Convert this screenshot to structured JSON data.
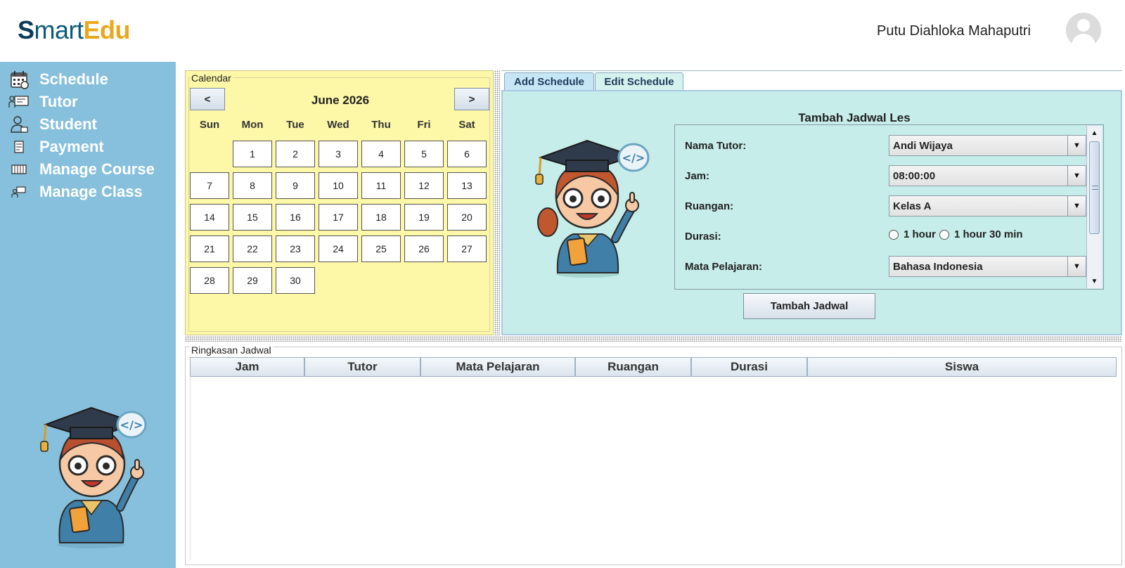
{
  "header": {
    "logo": {
      "s": "S",
      "mart": "mart",
      "edu": "Edu"
    },
    "user_name": "Putu Diahloka Mahaputri"
  },
  "sidebar": {
    "items": [
      {
        "label": "Schedule",
        "icon": "calendar-icon"
      },
      {
        "label": "Tutor",
        "icon": "tutor-icon"
      },
      {
        "label": "Student",
        "icon": "student-icon"
      },
      {
        "label": "Payment",
        "icon": "payment-icon"
      },
      {
        "label": "Manage Course",
        "icon": "course-icon"
      },
      {
        "label": "Manage Class",
        "icon": "class-icon"
      }
    ]
  },
  "calendar": {
    "legend": "Calendar",
    "prev_label": "<",
    "next_label": ">",
    "month_title": "June 2026",
    "weekdays": [
      "Sun",
      "Mon",
      "Tue",
      "Wed",
      "Thu",
      "Fri",
      "Sat"
    ],
    "first_weekday_index": 1,
    "days_in_month": 30
  },
  "tabs": {
    "items": [
      "Add Schedule",
      "Edit Schedule"
    ],
    "active": 0
  },
  "form": {
    "title": "Tambah Jadwal Les",
    "tutor": {
      "label": "Nama Tutor:",
      "value": "Andi Wijaya"
    },
    "jam": {
      "label": "Jam:",
      "value": "08:00:00"
    },
    "ruangan": {
      "label": "Ruangan:",
      "value": "Kelas A"
    },
    "durasi": {
      "label": "Durasi:",
      "options": [
        "1 hour",
        "1 hour 30 min"
      ],
      "selected": null
    },
    "mapel": {
      "label": "Mata Pelajaran:",
      "value": "Bahasa Indonesia"
    },
    "submit_label": "Tambah Jadwal"
  },
  "summary": {
    "legend": "Ringkasan Jadwal",
    "columns": [
      "Jam",
      "Tutor",
      "Mata Pelajaran",
      "Ruangan",
      "Durasi",
      "Siswa"
    ],
    "rows": []
  },
  "colors": {
    "sidebar": "#87c0dc",
    "calendar_bg": "#fdf7a8",
    "form_bg": "#c6ede9",
    "logo_dark": "#0b3b5a",
    "logo_accent": "#e9a71c"
  }
}
